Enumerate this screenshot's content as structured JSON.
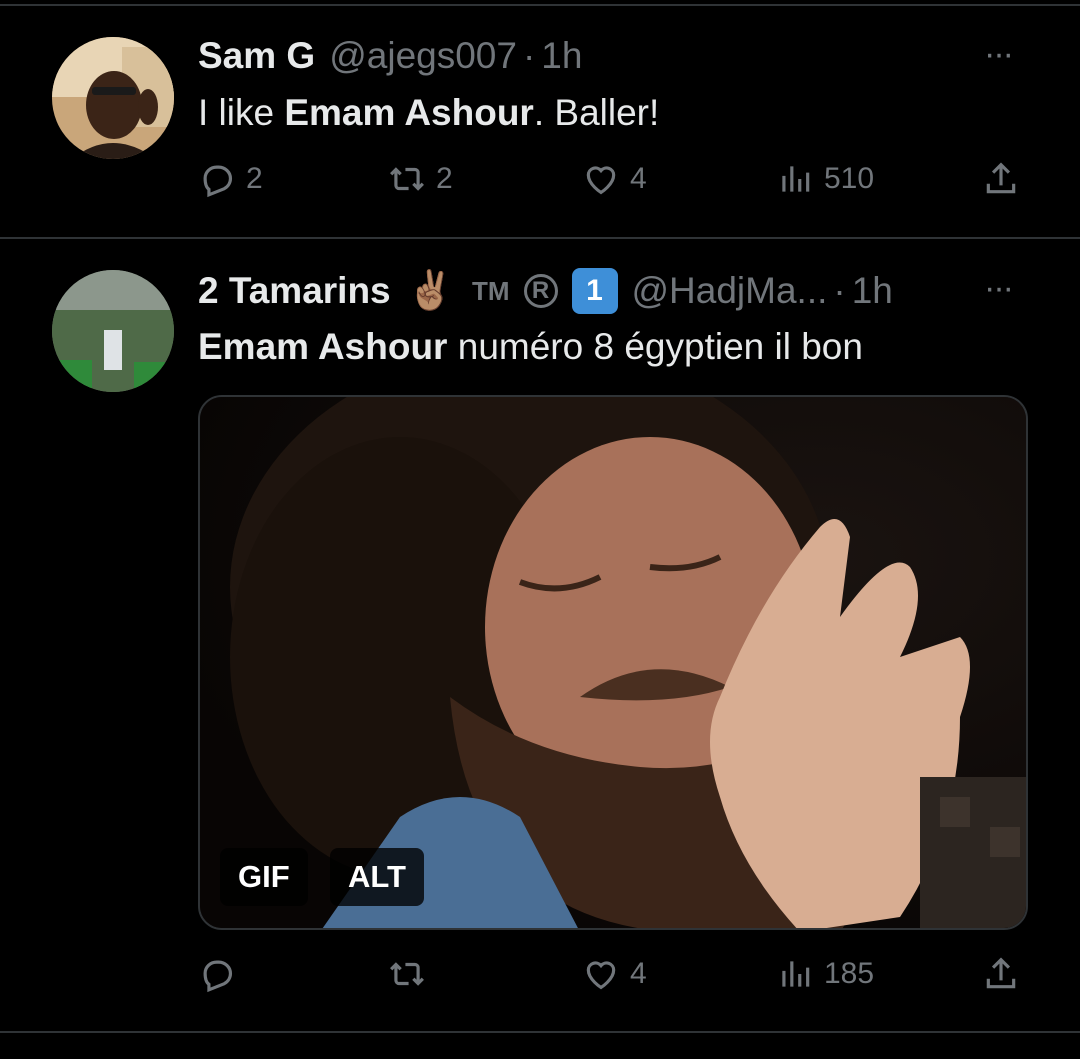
{
  "tweets": [
    {
      "display_name": "Sam G",
      "handle": "@ajegs007",
      "separator": "·",
      "time": "1h",
      "more_label": "···",
      "text": {
        "prefix": "I like ",
        "bold": "Emam Ashour",
        "suffix": ". Baller!"
      },
      "actions": {
        "replies": "2",
        "retweets": "2",
        "likes": "4",
        "views": "510"
      },
      "avatar_icon": "profile-photo"
    },
    {
      "display_name": "2 Tamarins",
      "badges": {
        "victory_emoji": "✌🏽",
        "tm": "TM",
        "registered": "R",
        "keycap": "1"
      },
      "handle": "@HadjMa...",
      "separator": "·",
      "time": "1h",
      "more_label": "···",
      "text": {
        "bold": "Emam Ashour",
        "suffix": " numéro 8 égyptien il bon"
      },
      "media": {
        "type": "gif",
        "gif_label": "GIF",
        "alt_label": "ALT"
      },
      "actions": {
        "replies": "",
        "retweets": "",
        "likes": "4",
        "views": "185"
      },
      "avatar_icon": "crowd-photo"
    }
  ],
  "colors": {
    "background": "#000000",
    "text": "#e7e9ea",
    "muted": "#71767b",
    "divider": "#2f3336"
  },
  "icons": {
    "reply": "reply-icon",
    "retweet": "retweet-icon",
    "like": "heart-icon",
    "views": "views-icon",
    "share": "share-icon"
  }
}
